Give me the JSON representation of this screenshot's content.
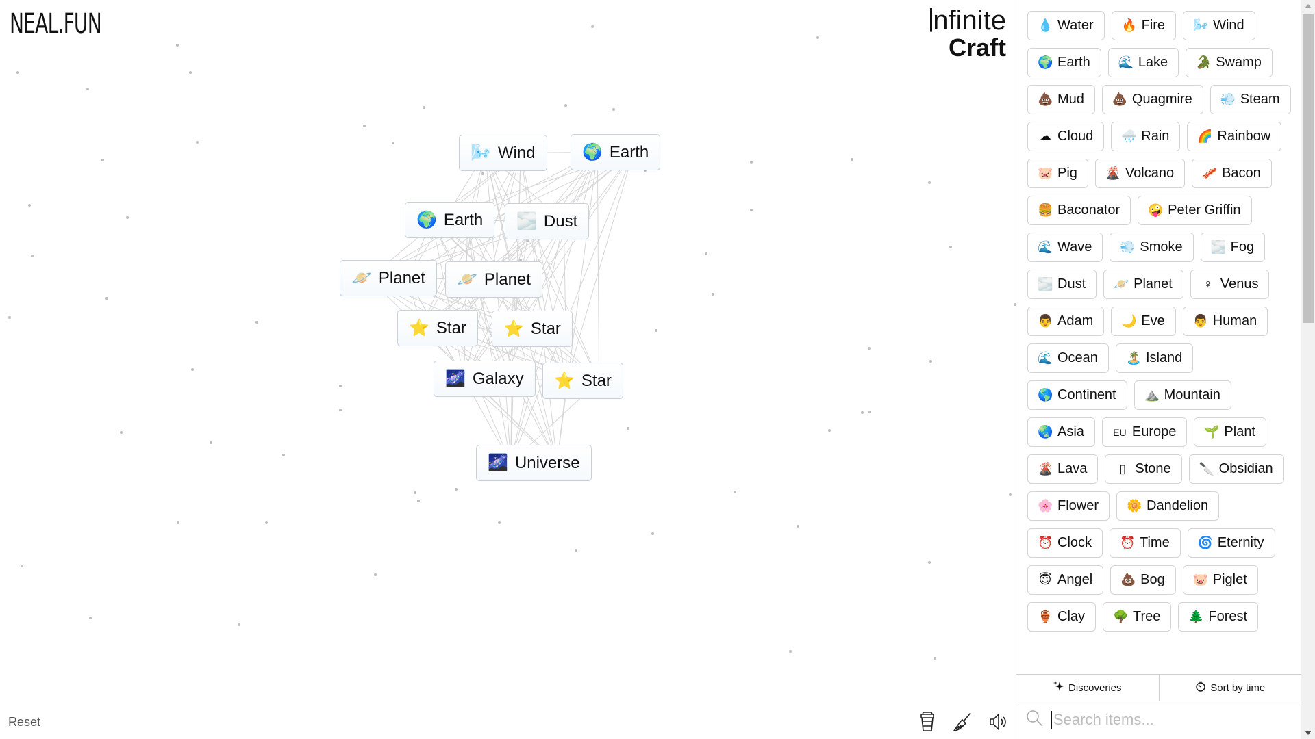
{
  "header": {
    "logo": "NEAL.FUN",
    "brand_line1": "nfinite",
    "brand_line2": "Craft"
  },
  "canvas": {
    "items": [
      {
        "emoji": "🌬️",
        "label": "Wind",
        "icon": "wind-face-icon"
      },
      {
        "emoji": "🌍",
        "label": "Earth",
        "icon": "globe-icon"
      },
      {
        "emoji": "🌍",
        "label": "Earth",
        "icon": "globe-icon"
      },
      {
        "emoji": "🌫️",
        "label": "Dust",
        "icon": "fog-waves-icon"
      },
      {
        "emoji": "🪐",
        "label": "Planet",
        "icon": "ringed-planet-icon"
      },
      {
        "emoji": "🪐",
        "label": "Planet",
        "icon": "ringed-planet-icon"
      },
      {
        "emoji": "⭐",
        "label": "Star",
        "icon": "star-icon"
      },
      {
        "emoji": "⭐",
        "label": "Star",
        "icon": "star-icon"
      },
      {
        "emoji": "🌌",
        "label": "Galaxy",
        "icon": "galaxy-icon"
      },
      {
        "emoji": "⭐",
        "label": "Star",
        "icon": "star-icon"
      },
      {
        "emoji": "🌌",
        "label": "Universe",
        "icon": "galaxy-icon"
      }
    ],
    "reset_label": "Reset",
    "tools": [
      {
        "name": "coffee-cup-icon",
        "label": "Support"
      },
      {
        "name": "broom-icon",
        "label": "Clear"
      },
      {
        "name": "speaker-icon",
        "label": "Sound"
      }
    ]
  },
  "sidebar": {
    "items": [
      {
        "emoji": "💧",
        "label": "Water"
      },
      {
        "emoji": "🔥",
        "label": "Fire"
      },
      {
        "emoji": "🌬️",
        "label": "Wind"
      },
      {
        "emoji": "🌍",
        "label": "Earth"
      },
      {
        "emoji": "🌊",
        "label": "Lake"
      },
      {
        "emoji": "🐊",
        "label": "Swamp"
      },
      {
        "emoji": "💩",
        "label": "Mud"
      },
      {
        "emoji": "💩",
        "label": "Quagmire"
      },
      {
        "emoji": "💨",
        "label": "Steam"
      },
      {
        "emoji": "☁",
        "label": "Cloud"
      },
      {
        "emoji": "🌧️",
        "label": "Rain"
      },
      {
        "emoji": "🌈",
        "label": "Rainbow"
      },
      {
        "emoji": "🐷",
        "label": "Pig"
      },
      {
        "emoji": "🌋",
        "label": "Volcano"
      },
      {
        "emoji": "🥓",
        "label": "Bacon"
      },
      {
        "emoji": "🍔",
        "label": "Baconator"
      },
      {
        "emoji": "🤪",
        "label": "Peter Griffin"
      },
      {
        "emoji": "🌊",
        "label": "Wave"
      },
      {
        "emoji": "💨",
        "label": "Smoke"
      },
      {
        "emoji": "🌫️",
        "label": "Fog"
      },
      {
        "emoji": "🌫️",
        "label": "Dust"
      },
      {
        "emoji": "🪐",
        "label": "Planet"
      },
      {
        "emoji": "♀",
        "label": "Venus"
      },
      {
        "emoji": "👨",
        "label": "Adam"
      },
      {
        "emoji": "🌙",
        "label": "Eve"
      },
      {
        "emoji": "👨",
        "label": "Human"
      },
      {
        "emoji": "🌊",
        "label": "Ocean"
      },
      {
        "emoji": "🏝️",
        "label": "Island"
      },
      {
        "emoji": "🌎",
        "label": "Continent"
      },
      {
        "emoji": "⛰️",
        "label": "Mountain"
      },
      {
        "emoji": "🌏",
        "label": "Asia"
      },
      {
        "emoji": "EU",
        "label": "Europe"
      },
      {
        "emoji": "🌱",
        "label": "Plant"
      },
      {
        "emoji": "🌋",
        "label": "Lava"
      },
      {
        "emoji": "▯",
        "label": "Stone"
      },
      {
        "emoji": "🔪",
        "label": "Obsidian"
      },
      {
        "emoji": "🌸",
        "label": "Flower"
      },
      {
        "emoji": "🌼",
        "label": "Dandelion"
      },
      {
        "emoji": "⏰",
        "label": "Clock"
      },
      {
        "emoji": "⏰",
        "label": "Time"
      },
      {
        "emoji": "🌀",
        "label": "Eternity"
      },
      {
        "emoji": "😇",
        "label": "Angel"
      },
      {
        "emoji": "💩",
        "label": "Bog"
      },
      {
        "emoji": "🐷",
        "label": "Piglet"
      },
      {
        "emoji": "🏺",
        "label": "Clay"
      },
      {
        "emoji": "🌳",
        "label": "Tree"
      },
      {
        "emoji": "🌲",
        "label": "Forest"
      }
    ],
    "tabs": {
      "discoveries": "Discoveries",
      "sort": "Sort by time"
    },
    "search": {
      "placeholder": "Search items...",
      "value": ""
    },
    "scroll_position": 0
  },
  "colors": {
    "item_border": "#c8d0dc",
    "sidebar_border": "#d4d4d4",
    "scroll_thumb": "#c1c1c1"
  }
}
